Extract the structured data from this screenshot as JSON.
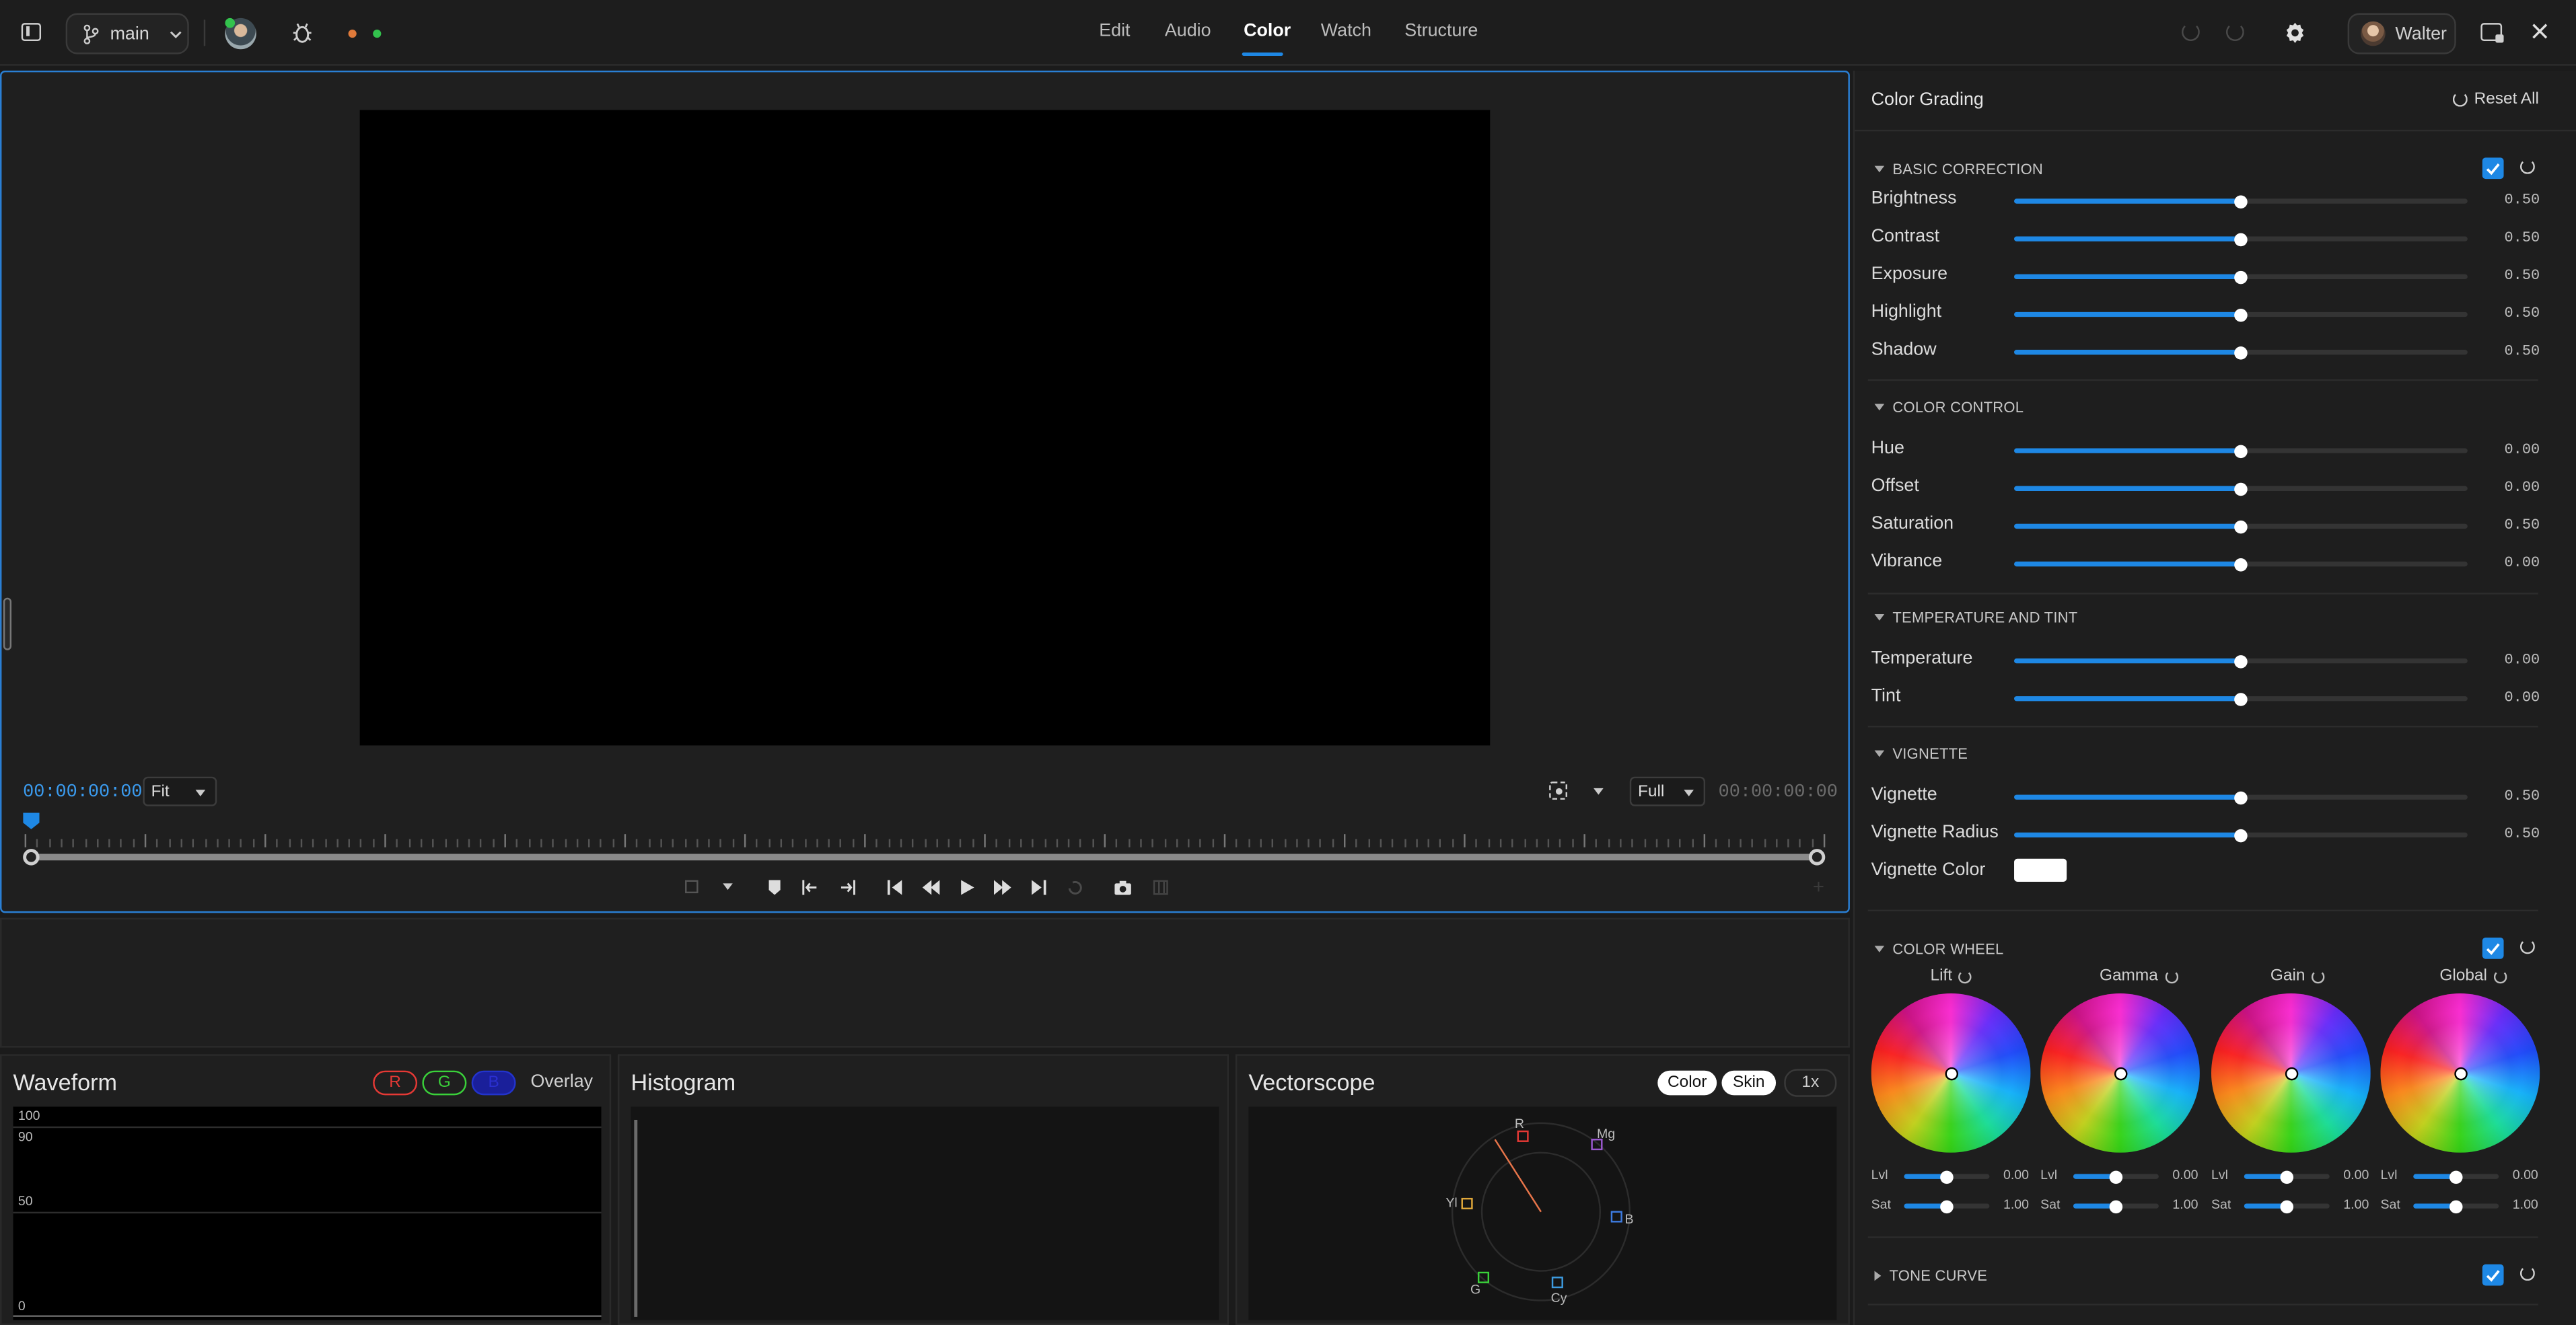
{
  "topbar": {
    "branch": "main",
    "tabs": [
      "Edit",
      "Audio",
      "Color",
      "Watch",
      "Structure"
    ],
    "active_tab": "Color",
    "user": "Walter"
  },
  "viewer": {
    "timecode_left": "00:00:00:00",
    "fit_select": "Fit",
    "quality_select": "Full",
    "timecode_right": "00:00:00:00"
  },
  "scopes": {
    "waveform": {
      "title": "Waveform",
      "r": "R",
      "g": "G",
      "b": "B",
      "overlay": "Overlay",
      "y_labels": [
        "100",
        "90",
        "50",
        "0"
      ]
    },
    "histogram": {
      "title": "Histogram"
    },
    "vectorscope": {
      "title": "Vectorscope",
      "color_btn": "Color",
      "skin_btn": "Skin",
      "zoom": "1x",
      "targets": [
        "R",
        "Mg",
        "B",
        "Cy",
        "G",
        "Yl"
      ]
    }
  },
  "grading": {
    "title": "Color Grading",
    "reset_all": "Reset All",
    "basic": {
      "title": "BASIC CORRECTION",
      "sliders": [
        {
          "label": "Brightness",
          "value": "0.50",
          "level": 0.5
        },
        {
          "label": "Contrast",
          "value": "0.50",
          "level": 0.5
        },
        {
          "label": "Exposure",
          "value": "0.50",
          "level": 0.5
        },
        {
          "label": "Highlight",
          "value": "0.50",
          "level": 0.5
        },
        {
          "label": "Shadow",
          "value": "0.50",
          "level": 0.5
        }
      ]
    },
    "color_control": {
      "title": "COLOR CONTROL",
      "sliders": [
        {
          "label": "Hue",
          "value": "0.00",
          "level": 0.5
        },
        {
          "label": "Offset",
          "value": "0.00",
          "level": 0.5
        },
        {
          "label": "Saturation",
          "value": "0.50",
          "level": 0.5
        },
        {
          "label": "Vibrance",
          "value": "0.00",
          "level": 0.5
        }
      ]
    },
    "temp": {
      "title": "TEMPERATURE AND TINT",
      "sliders": [
        {
          "label": "Temperature",
          "value": "0.00",
          "level": 0.5
        },
        {
          "label": "Tint",
          "value": "0.00",
          "level": 0.5
        }
      ]
    },
    "vignette": {
      "title": "VIGNETTE",
      "sliders": [
        {
          "label": "Vignette",
          "value": "0.50",
          "level": 0.5
        },
        {
          "label": "Vignette Radius",
          "value": "0.50",
          "level": 0.5
        }
      ],
      "color_label": "Vignette Color",
      "color": "#ffffff"
    },
    "wheel": {
      "title": "COLOR WHEEL",
      "wheels": [
        {
          "label": "Lift",
          "lvl": "0.00",
          "sat": "1.00"
        },
        {
          "label": "Gamma",
          "lvl": "0.00",
          "sat": "1.00"
        },
        {
          "label": "Gain",
          "lvl": "0.00",
          "sat": "1.00"
        },
        {
          "label": "Global",
          "lvl": "0.00",
          "sat": "1.00"
        }
      ],
      "lvl_label": "Lvl",
      "sat_label": "Sat"
    },
    "tone_curve": {
      "title": "TONE CURVE"
    }
  },
  "colors": {
    "accent": "#1e88e5",
    "selection": "#2a7fd4"
  }
}
